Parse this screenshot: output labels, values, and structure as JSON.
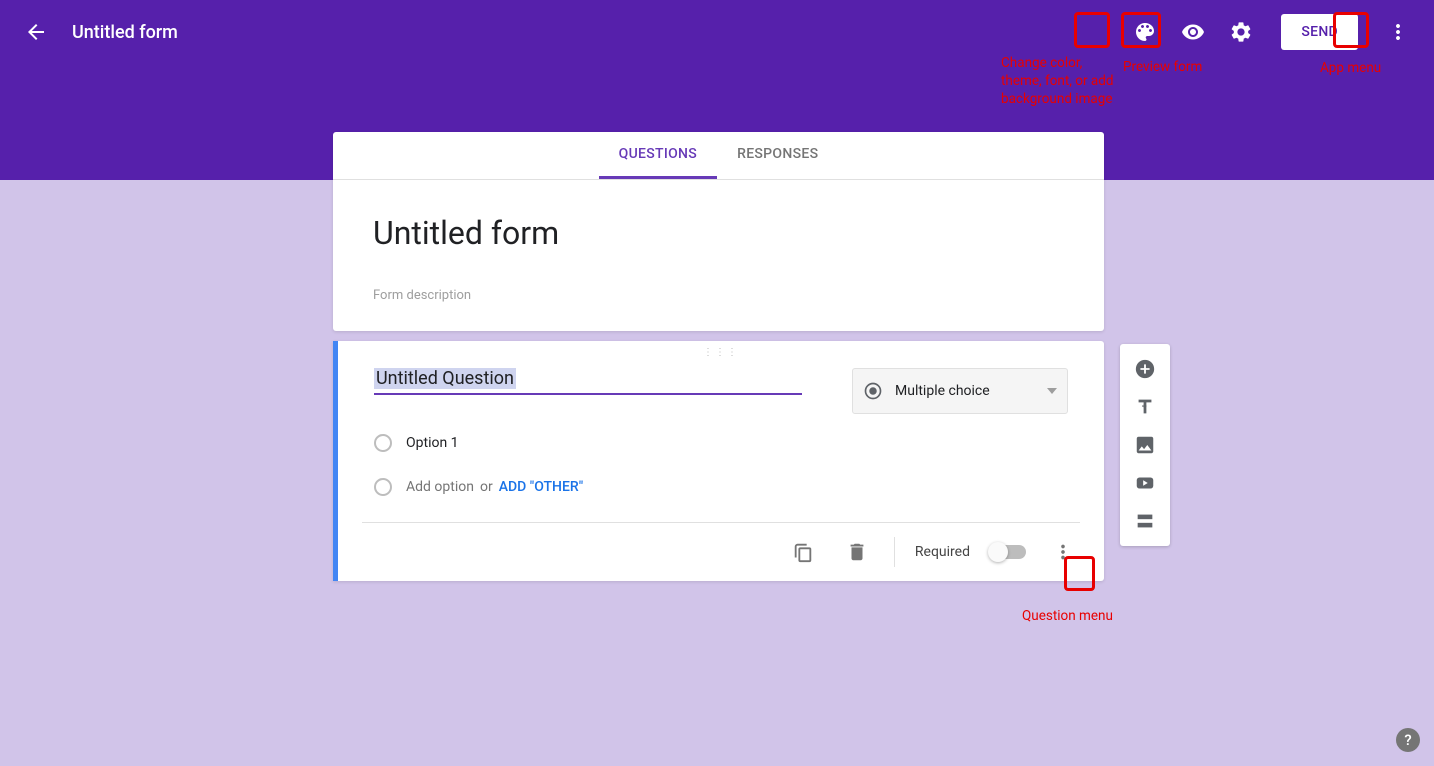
{
  "header": {
    "title": "Untitled form",
    "send_label": "SEND"
  },
  "annotations": {
    "palette": "Change color, theme, font, or add background image",
    "preview": "Preview form",
    "app_menu": "App menu",
    "question_menu": "Question menu"
  },
  "tabs": {
    "questions": "QUESTIONS",
    "responses": "RESPONSES"
  },
  "form": {
    "title": "Untitled form",
    "description_placeholder": "Form description"
  },
  "question": {
    "text": "Untitled Question",
    "type_label": "Multiple choice",
    "option1": "Option 1",
    "add_option": "Add option",
    "or": "or",
    "add_other": "ADD \"OTHER\"",
    "required_label": "Required"
  }
}
